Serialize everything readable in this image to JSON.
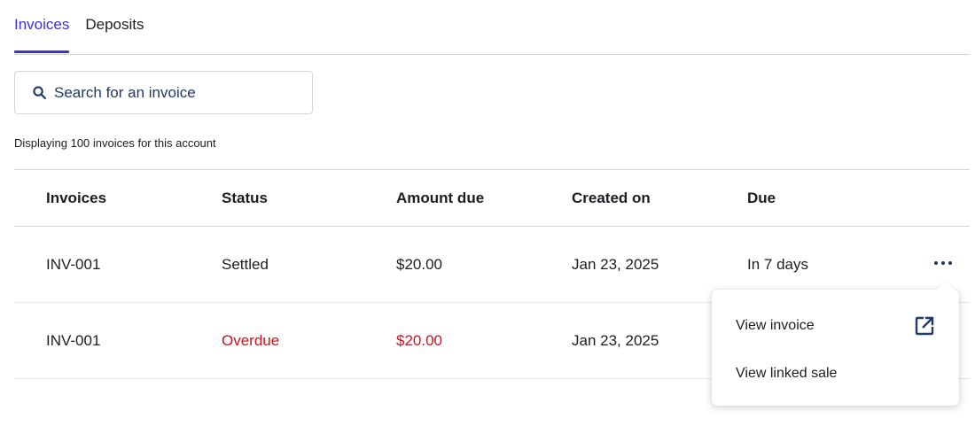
{
  "tabs": [
    {
      "label": "Invoices",
      "active": true
    },
    {
      "label": "Deposits",
      "active": false
    }
  ],
  "search": {
    "placeholder": "Search for an invoice",
    "icon": "search-icon"
  },
  "count_text": "Displaying 100 invoices for this account",
  "table": {
    "columns": [
      "Invoices",
      "Status",
      "Amount due",
      "Created on",
      "Due"
    ],
    "rows": [
      {
        "invoice": "INV-001",
        "status": "Settled",
        "amount": "$20.00",
        "created": "Jan 23, 2025",
        "due": "In 7 days"
      },
      {
        "invoice": "INV-001",
        "status": "Overdue",
        "amount": "$20.00",
        "created": "Jan 23, 2025",
        "due": ""
      }
    ]
  },
  "menu": {
    "items": [
      {
        "label": "View invoice",
        "icon": "external-link-icon"
      },
      {
        "label": "View linked sale"
      }
    ]
  },
  "colors": {
    "accent": "#3b32d9",
    "overdue": "#d0101a",
    "icon": "#1d3a6b"
  }
}
